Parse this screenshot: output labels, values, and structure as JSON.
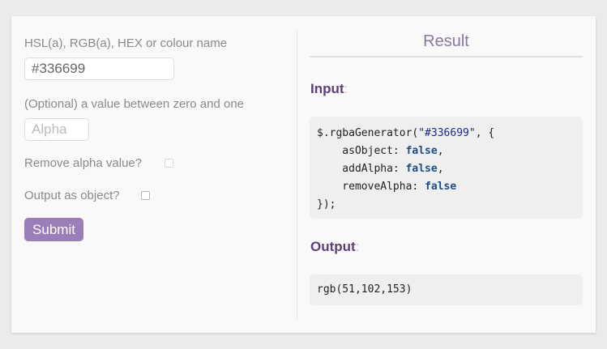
{
  "form": {
    "colour_label": "HSL(a), RGB(a), HEX or colour name",
    "colour_value": "#336699",
    "alpha_label": "(Optional) a value between zero and one",
    "alpha_placeholder": "Alpha",
    "remove_alpha_label": "Remove alpha value?",
    "remove_alpha_checked": false,
    "output_object_label": "Output as object?",
    "output_object_checked": false,
    "submit_label": "Submit"
  },
  "result": {
    "title": "Result",
    "input_heading": "Input",
    "input_code": {
      "call_open": "$.rgbaGenerator(",
      "arg_string": "\"#336699\"",
      "call_after_arg": ", {",
      "opt1_key": "    asObject: ",
      "opt1_val": "false",
      "opt1_end": ",",
      "opt2_key": "    addAlpha: ",
      "opt2_val": "false",
      "opt2_end": ",",
      "opt3_key": "    removeAlpha: ",
      "opt3_val": "false",
      "close": "});"
    },
    "output_heading": "Output",
    "output_value": "rgb(51,102,153)"
  },
  "colors": {
    "accent": "#9a7eb8",
    "heading": "#5c3e7a",
    "page_bg": "#ebebeb",
    "card_bg": "#f9f9f9"
  }
}
